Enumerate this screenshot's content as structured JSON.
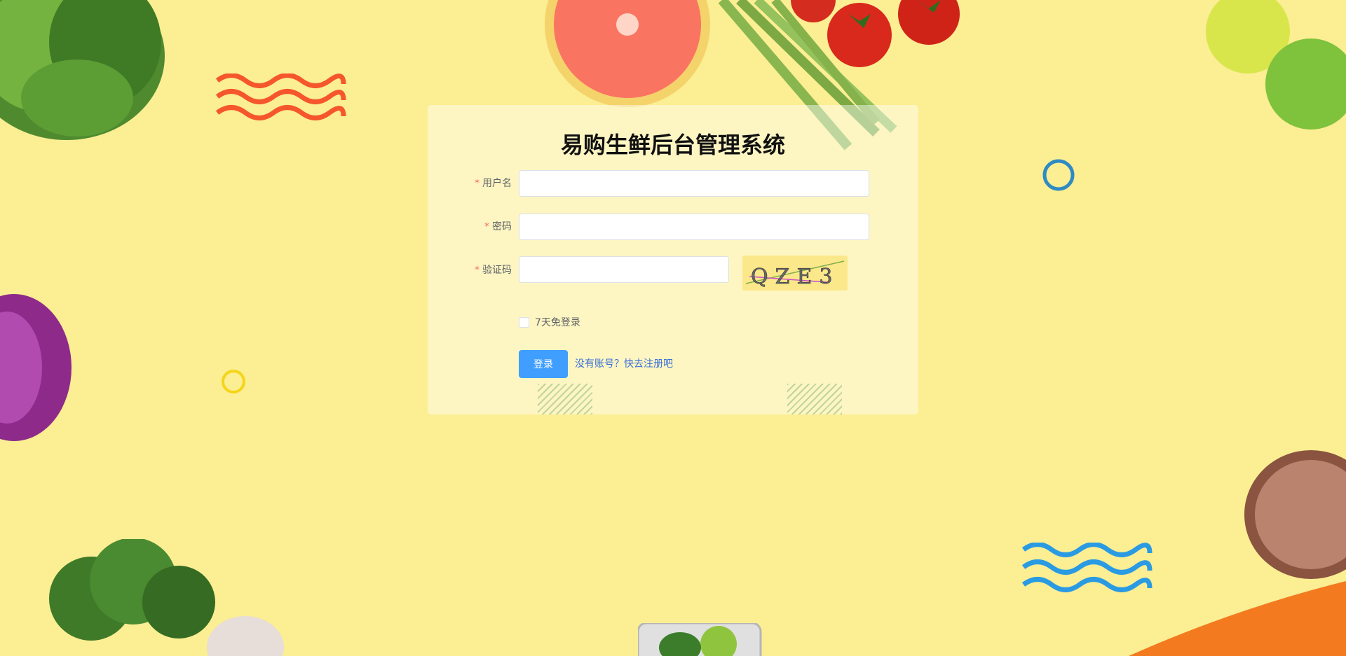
{
  "title": "易购生鲜后台管理系统",
  "form": {
    "required_mark": "*",
    "username_label": "用户名",
    "password_label": "密码",
    "captcha_label": "验证码",
    "username_value": "",
    "password_value": "",
    "captcha_value": "",
    "captcha_image_text": "QZE3",
    "remember_label": "7天免登录",
    "remember_checked": false,
    "login_button": "登录",
    "register_link": "没有账号？快去注册吧"
  },
  "colors": {
    "background": "#fbee93",
    "primary_button": "#409eff",
    "required": "#f56c6c",
    "link": "#3a6fd8"
  }
}
